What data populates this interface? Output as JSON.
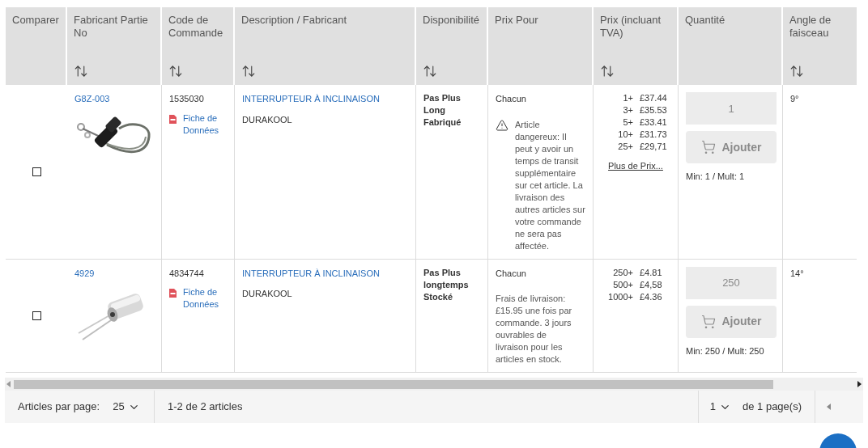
{
  "table": {
    "columns": [
      {
        "label": "Comparer",
        "sortable": false
      },
      {
        "label": "Fabricant Partie No",
        "sortable": true
      },
      {
        "label": "Code de Commande",
        "sortable": true
      },
      {
        "label": "Description / Fabricant",
        "sortable": true
      },
      {
        "label": "Disponibilité",
        "sortable": true
      },
      {
        "label": "Prix Pour",
        "sortable": false
      },
      {
        "label": "Prix (incluant TVA)",
        "sortable": true
      },
      {
        "label": "Quantité",
        "sortable": false
      },
      {
        "label": "Angle de faisceau",
        "sortable": true
      }
    ],
    "rows": [
      {
        "compare_checked": false,
        "part_no": "G8Z-003",
        "order_code": "1535030",
        "datasheet_link": "Fiche de Données",
        "description": "INTERRUPTEUR À INCLINAISON",
        "manufacturer": "DURAKOOL",
        "availability": "Pas Plus Long Fabriqué",
        "price_for": "Chacun",
        "note": {
          "kind": "warning",
          "text": "Article dangereux: Il peut y avoir un temps de transit supplémentaire sur cet article. La livraison des autres articles sur votre commande ne sera pas affectée."
        },
        "prices": [
          {
            "qty": "1+",
            "price": "£37.44"
          },
          {
            "qty": "3+",
            "price": "£35.53"
          },
          {
            "qty": "5+",
            "price": "£33.41"
          },
          {
            "qty": "10+",
            "price": "£31.73"
          },
          {
            "qty": "25+",
            "price": "£29,71"
          }
        ],
        "more_prices_link": "Plus de Prix...",
        "quantity": {
          "value": "1",
          "disabled": true
        },
        "add_button": {
          "label": "Ajouter",
          "disabled": true
        },
        "min_mult": "Min: 1 / Mult: 1",
        "angle": "9°"
      },
      {
        "compare_checked": false,
        "part_no": "4929",
        "order_code": "4834744",
        "datasheet_link": "Fiche de Données",
        "description": "INTERRUPTEUR À INCLINAISON",
        "manufacturer": "DURAKOOL",
        "availability": "Pas Plus longtemps Stocké",
        "price_for": "Chacun",
        "note": {
          "kind": "info",
          "text": "Frais de livraison: £15.95 une fois par commande. 3 jours ouvrables de livraison pour les articles en stock."
        },
        "prices": [
          {
            "qty": "250+",
            "price": "£4.81"
          },
          {
            "qty": "500+",
            "price": "£4,58"
          },
          {
            "qty": "1000+",
            "price": "£4.36"
          }
        ],
        "quantity": {
          "value": "250",
          "disabled": true
        },
        "add_button": {
          "label": "Ajouter",
          "disabled": true
        },
        "min_mult": "Min: 250 / Mult: 250",
        "angle": "14°"
      }
    ]
  },
  "pagination": {
    "per_page_label": "Articles par page:",
    "per_page": "25",
    "range": "1-2 de 2 articles",
    "page": "1",
    "page_total": "de 1 page(s)"
  }
}
